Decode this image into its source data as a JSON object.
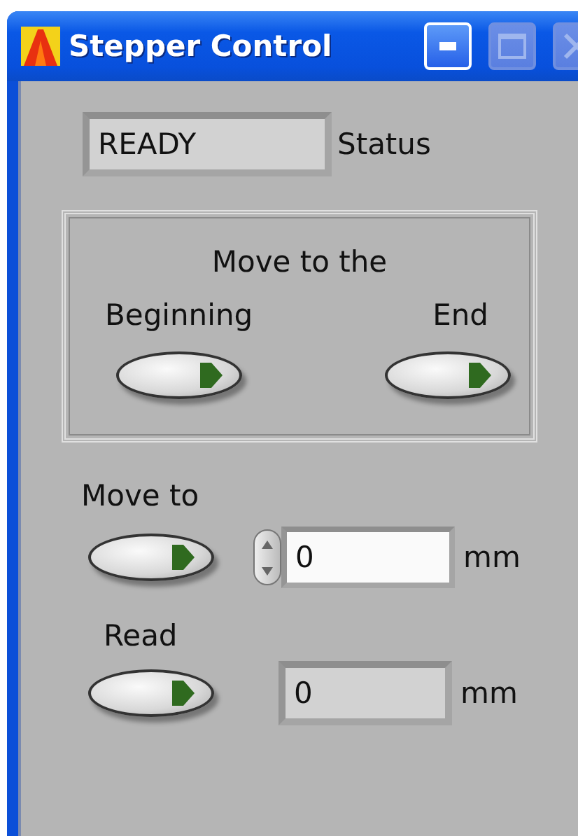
{
  "window": {
    "title": "Stepper Control"
  },
  "status": {
    "value": "READY",
    "label": "Status"
  },
  "move_group": {
    "caption": "Move to the",
    "buttons": [
      {
        "label": "Beginning"
      },
      {
        "label": "End"
      }
    ]
  },
  "move_to": {
    "label": "Move to",
    "value": "0",
    "unit": "mm"
  },
  "read": {
    "label": "Read",
    "value": "0",
    "unit": "mm"
  }
}
